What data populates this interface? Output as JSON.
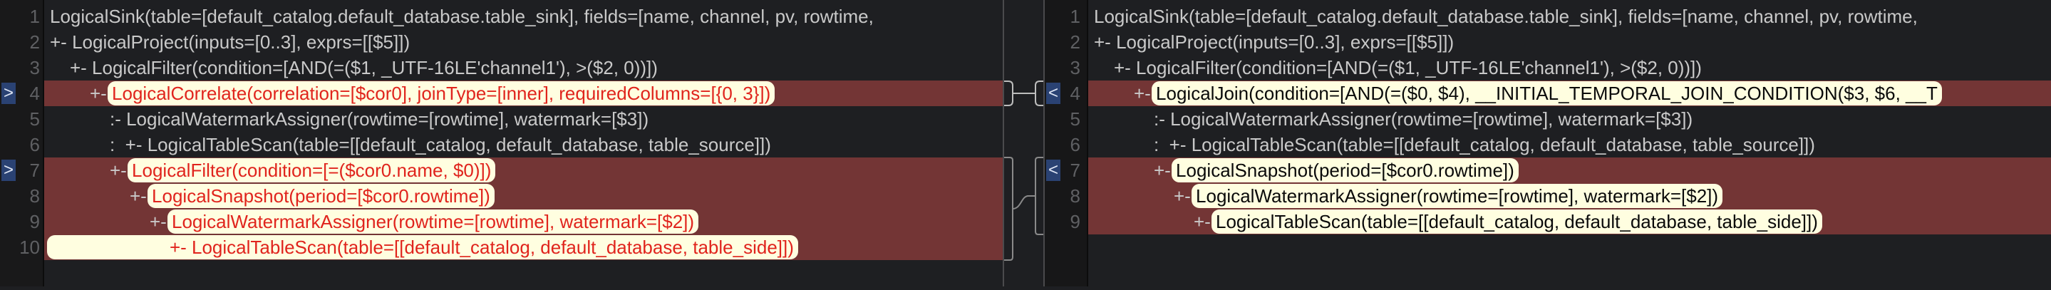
{
  "colors": {
    "background": "#1e1f22",
    "changed_row": "#733535",
    "pill": "#fffee0",
    "removed_text": "#e0241d",
    "marker": "#2a4273"
  },
  "left": {
    "markers": [
      {
        "line": 4,
        "icon": "chevron-right",
        "glyph": ">"
      },
      {
        "line": 7,
        "icon": "chevron-right",
        "glyph": ">"
      }
    ],
    "lines": [
      {
        "num": "1",
        "prefix": "LogicalSink(table=[default_catalog.default_database.table_sink], fields=[name, channel, pv, rowtime,",
        "changed": "",
        "suffix": "",
        "row_changed": false
      },
      {
        "num": "2",
        "prefix": "+- LogicalProject(inputs=[0..3], exprs=[[$5]])",
        "changed": "",
        "suffix": "",
        "row_changed": false
      },
      {
        "num": "3",
        "prefix": "   +- LogicalFilter(condition=[AND(=($1, _UTF-16LE'channel1'), >($2, 0))])",
        "changed": "",
        "suffix": "",
        "row_changed": false
      },
      {
        "num": "4",
        "prefix": "      +- ",
        "changed": "LogicalCorrelate(correlation=[$cor0], joinType=[inner], requiredColumns=[{0, 3}])",
        "suffix": "",
        "row_changed": true
      },
      {
        "num": "5",
        "prefix": "         :- LogicalWatermarkAssigner(rowtime=[rowtime], watermark=[$3])",
        "changed": "",
        "suffix": "",
        "row_changed": false
      },
      {
        "num": "6",
        "prefix": "         :  +- LogicalTableScan(table=[[default_catalog, default_database, table_source]])",
        "changed": "",
        "suffix": "",
        "row_changed": false
      },
      {
        "num": "7",
        "prefix": "         +- ",
        "changed": "LogicalFilter(condition=[=($cor0.name, $0)])",
        "suffix": "",
        "row_changed": true
      },
      {
        "num": "8",
        "prefix": "            +- ",
        "changed": "LogicalSnapshot(period=[$cor0.rowtime])",
        "suffix": "",
        "row_changed": true
      },
      {
        "num": "9",
        "prefix": "               +- ",
        "changed": "LogicalWatermarkAssigner(rowtime=[rowtime], watermark=[$2])",
        "suffix": "",
        "row_changed": true
      },
      {
        "num": "10",
        "prefix": "",
        "changed": "                  +- LogicalTableScan(table=[[default_catalog, default_database, table_side]])",
        "suffix": "",
        "row_changed": true
      }
    ]
  },
  "right": {
    "markers": [
      {
        "line": 4,
        "icon": "chevron-left",
        "glyph": "<"
      },
      {
        "line": 7,
        "icon": "chevron-left",
        "glyph": "<"
      }
    ],
    "lines": [
      {
        "num": "1",
        "prefix": "LogicalSink(table=[default_catalog.default_database.table_sink], fields=[name, channel, pv, rowtime,",
        "changed": "",
        "suffix": "",
        "row_changed": false
      },
      {
        "num": "2",
        "prefix": "+- LogicalProject(inputs=[0..3], exprs=[[$5]])",
        "changed": "",
        "suffix": "",
        "row_changed": false
      },
      {
        "num": "3",
        "prefix": "   +- LogicalFilter(condition=[AND(=($1, _UTF-16LE'channel1'), >($2, 0))])",
        "changed": "",
        "suffix": "",
        "row_changed": false
      },
      {
        "num": "4",
        "prefix": "      +- ",
        "changed": "LogicalJoin(condition=[AND(=($0, $4), __INITIAL_TEMPORAL_JOIN_CONDITION($3, $6, __T",
        "suffix": "",
        "row_changed": true
      },
      {
        "num": "5",
        "prefix": "         :- LogicalWatermarkAssigner(rowtime=[rowtime], watermark=[$3])",
        "changed": "",
        "suffix": "",
        "row_changed": false
      },
      {
        "num": "6",
        "prefix": "         :  +- LogicalTableScan(table=[[default_catalog, default_database, table_source]])",
        "changed": "",
        "suffix": "",
        "row_changed": false
      },
      {
        "num": "7",
        "prefix": "         +- ",
        "changed": "LogicalSnapshot(period=[$cor0.rowtime])",
        "suffix": "",
        "row_changed": true
      },
      {
        "num": "8",
        "prefix": "            +- ",
        "changed": "LogicalWatermarkAssigner(rowtime=[rowtime], watermark=[$2])",
        "suffix": "",
        "row_changed": true
      },
      {
        "num": "9",
        "prefix": "               +- ",
        "changed": "LogicalTableScan(table=[[default_catalog, default_database, table_side]])",
        "suffix": "",
        "row_changed": true
      }
    ]
  }
}
